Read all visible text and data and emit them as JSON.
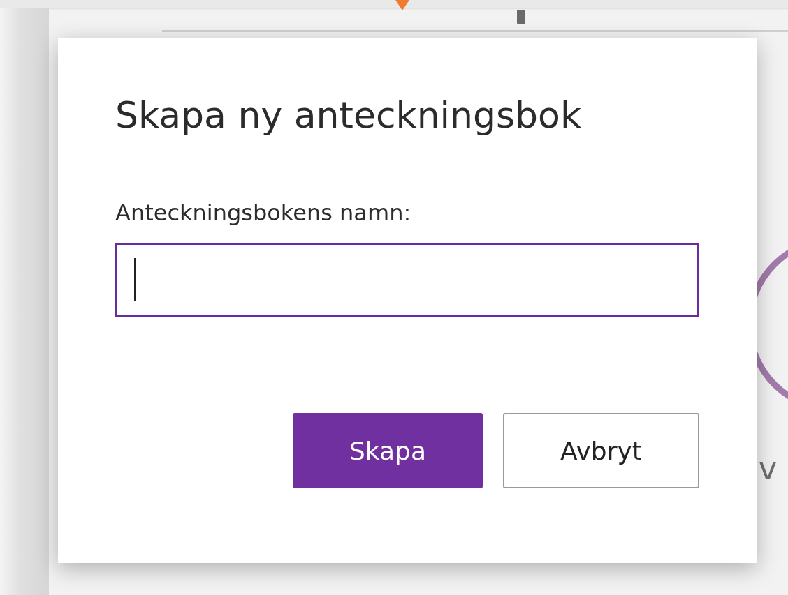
{
  "background": {
    "partial_text": "v"
  },
  "dialog": {
    "title": "Skapa ny anteckningsbok",
    "field_label": "Anteckningsbokens namn:",
    "name_field": {
      "focused": true
    },
    "buttons": [
      {
        "label": "Skapa",
        "kind": "primary"
      },
      {
        "label": "Avbryt",
        "kind": "secondary"
      }
    ]
  }
}
